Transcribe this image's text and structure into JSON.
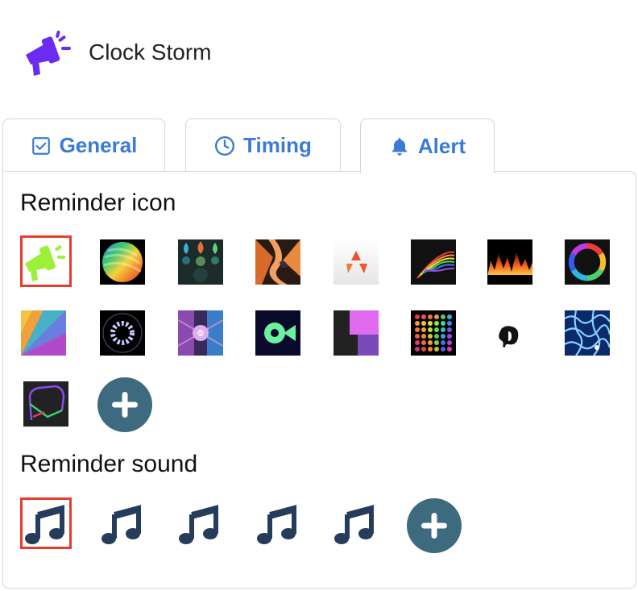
{
  "app": {
    "title": "Clock Storm",
    "logo_icon": "megaphone-icon",
    "brand_color": "#6a2cf0"
  },
  "tabs": [
    {
      "label": "General",
      "icon": "checkbox-icon",
      "active": false
    },
    {
      "label": "Timing",
      "icon": "clock-icon",
      "active": false
    },
    {
      "label": "Alert",
      "icon": "bell-icon",
      "active": true
    }
  ],
  "alert": {
    "reminder_icon_title": "Reminder icon",
    "reminder_sound_title": "Reminder sound",
    "icons": [
      "megaphone-icon",
      "rainbow-sphere-icon",
      "paint-drops-icon",
      "orange-swirl-icon",
      "triangle-shards-icon",
      "spectrum-wave-icon",
      "fire-icon",
      "color-wheel-icon",
      "gradient-fan-icon",
      "dotted-ring-icon",
      "tunnel-icon",
      "fish-icon",
      "stacked-squares-icon",
      "led-grid-icon",
      "ink-splash-icon",
      "water-caustics-icon",
      "neon-curve-icon"
    ],
    "selected_icon_index": 0,
    "sounds": [
      "music-note-icon",
      "music-note-icon",
      "music-note-icon",
      "music-note-icon",
      "music-note-icon"
    ],
    "selected_sound_index": 0,
    "add_icon": "plus-icon",
    "accent_color": "#3a7bd5",
    "selection_color": "#e53c2e",
    "add_button_color": "#3d6a7e",
    "note_color": "#253d5b"
  }
}
